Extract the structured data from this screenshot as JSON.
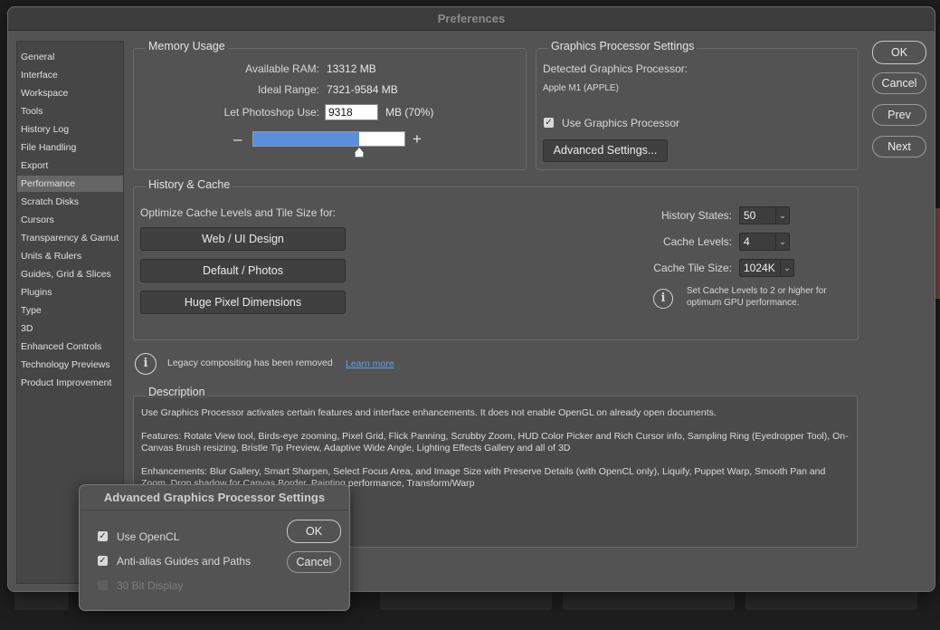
{
  "window": {
    "title": "Preferences"
  },
  "sidebar": {
    "items": [
      {
        "label": "General"
      },
      {
        "label": "Interface"
      },
      {
        "label": "Workspace"
      },
      {
        "label": "Tools"
      },
      {
        "label": "History Log"
      },
      {
        "label": "File Handling"
      },
      {
        "label": "Export"
      },
      {
        "label": "Performance",
        "selected": true
      },
      {
        "label": "Scratch Disks"
      },
      {
        "label": "Cursors"
      },
      {
        "label": "Transparency & Gamut"
      },
      {
        "label": "Units & Rulers"
      },
      {
        "label": "Guides, Grid & Slices"
      },
      {
        "label": "Plugins"
      },
      {
        "label": "Type"
      },
      {
        "label": "3D"
      },
      {
        "label": "Enhanced Controls"
      },
      {
        "label": "Technology Previews"
      },
      {
        "label": "Product Improvement"
      }
    ]
  },
  "memory": {
    "title": "Memory Usage",
    "available_label": "Available RAM:",
    "available_value": "13312 MB",
    "ideal_label": "Ideal Range:",
    "ideal_value": "7321-9584 MB",
    "let_label": "Let Photoshop Use:",
    "let_value": "9318",
    "let_unit": "MB (70%)",
    "minus": "–",
    "plus": "+",
    "slider_fraction": 0.7
  },
  "gpu": {
    "title": "Graphics Processor Settings",
    "detected_label": "Detected Graphics Processor:",
    "detected_value": "Apple M1 (APPLE)",
    "use_gpu_label": "Use Graphics Processor",
    "use_gpu_checked": true,
    "advanced_button": "Advanced Settings..."
  },
  "dialog_buttons": {
    "ok": "OK",
    "cancel": "Cancel",
    "prev": "Prev",
    "next": "Next"
  },
  "history_cache": {
    "title": "History & Cache",
    "optimize_label": "Optimize Cache Levels and Tile Size for:",
    "btn_web": "Web / UI Design",
    "btn_default": "Default / Photos",
    "btn_huge": "Huge Pixel Dimensions",
    "history_states_label": "History States:",
    "history_states_value": "50",
    "cache_levels_label": "Cache Levels:",
    "cache_levels_value": "4",
    "tile_size_label": "Cache Tile Size:",
    "tile_size_value": "1024K",
    "tip_line1": "Set Cache Levels to 2 or higher for",
    "tip_line2": "optimum GPU performance."
  },
  "legacy": {
    "text": "Legacy compositing has been removed",
    "link": "Learn more"
  },
  "description": {
    "title": "Description",
    "p1": "Use Graphics Processor activates certain features and interface enhancements. It does not enable OpenGL on already open documents.",
    "p2": "Features: Rotate View tool, Birds-eye zooming, Pixel Grid, Flick Panning, Scrubby Zoom, HUD Color Picker and Rich Cursor info, Sampling Ring (Eyedropper Tool), On-Canvas Brush resizing, Bristle Tip Preview, Adaptive Wide Angle, Lighting Effects Gallery and all of 3D",
    "p3": "Enhancements: Blur Gallery, Smart Sharpen, Select Focus Area, and Image Size with Preserve Details (with OpenCL only), Liquify, Puppet Warp, Smooth Pan and Zoom, Drop shadow for Canvas Border, Painting performance, Transform/Warp"
  },
  "advanced_dialog": {
    "title": "Advanced Graphics Processor Settings",
    "opencl_label": "Use OpenCL",
    "opencl_checked": true,
    "antialias_label": "Anti-alias Guides and Paths",
    "antialias_checked": true,
    "bit30_label": "30 Bit Display",
    "bit30_checked": false,
    "bit30_disabled": true,
    "ok": "OK",
    "cancel": "Cancel"
  },
  "colors": {
    "accent": "#5a8fe0",
    "link": "#5aa0f0",
    "panel": "#535353"
  }
}
